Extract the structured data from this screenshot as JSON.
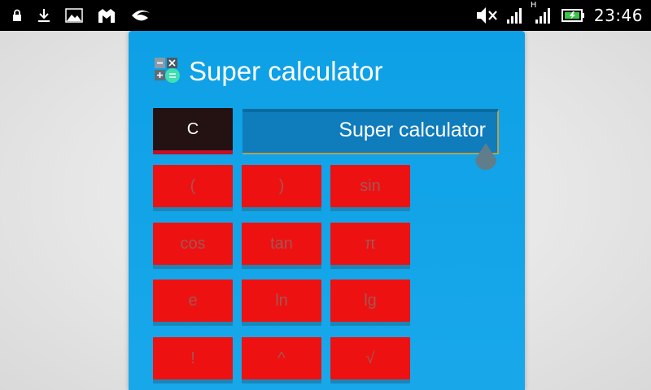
{
  "status_bar": {
    "clock": "23:46",
    "network_type": "H",
    "icons": [
      "lock-icon",
      "download-icon",
      "image-icon",
      "app-icon",
      "swift-icon",
      "mute-icon",
      "signal-icon",
      "signal-icon",
      "battery-charging-icon"
    ]
  },
  "app": {
    "title": "Super calculator",
    "display_text": "Super calculator",
    "clear_label": "C"
  },
  "keypad": {
    "rows": [
      [
        "(",
        ")",
        "sin"
      ],
      [
        "cos",
        "tan",
        "π"
      ],
      [
        "e",
        "ln",
        "lg"
      ],
      [
        "!",
        "^",
        "√"
      ]
    ]
  },
  "colors": {
    "card_bg": "#0ea0e6",
    "button_bg": "#ee1111",
    "button_text": "#a35555",
    "clear_bg": "#241212",
    "display_bg": "#0f7cbc"
  }
}
